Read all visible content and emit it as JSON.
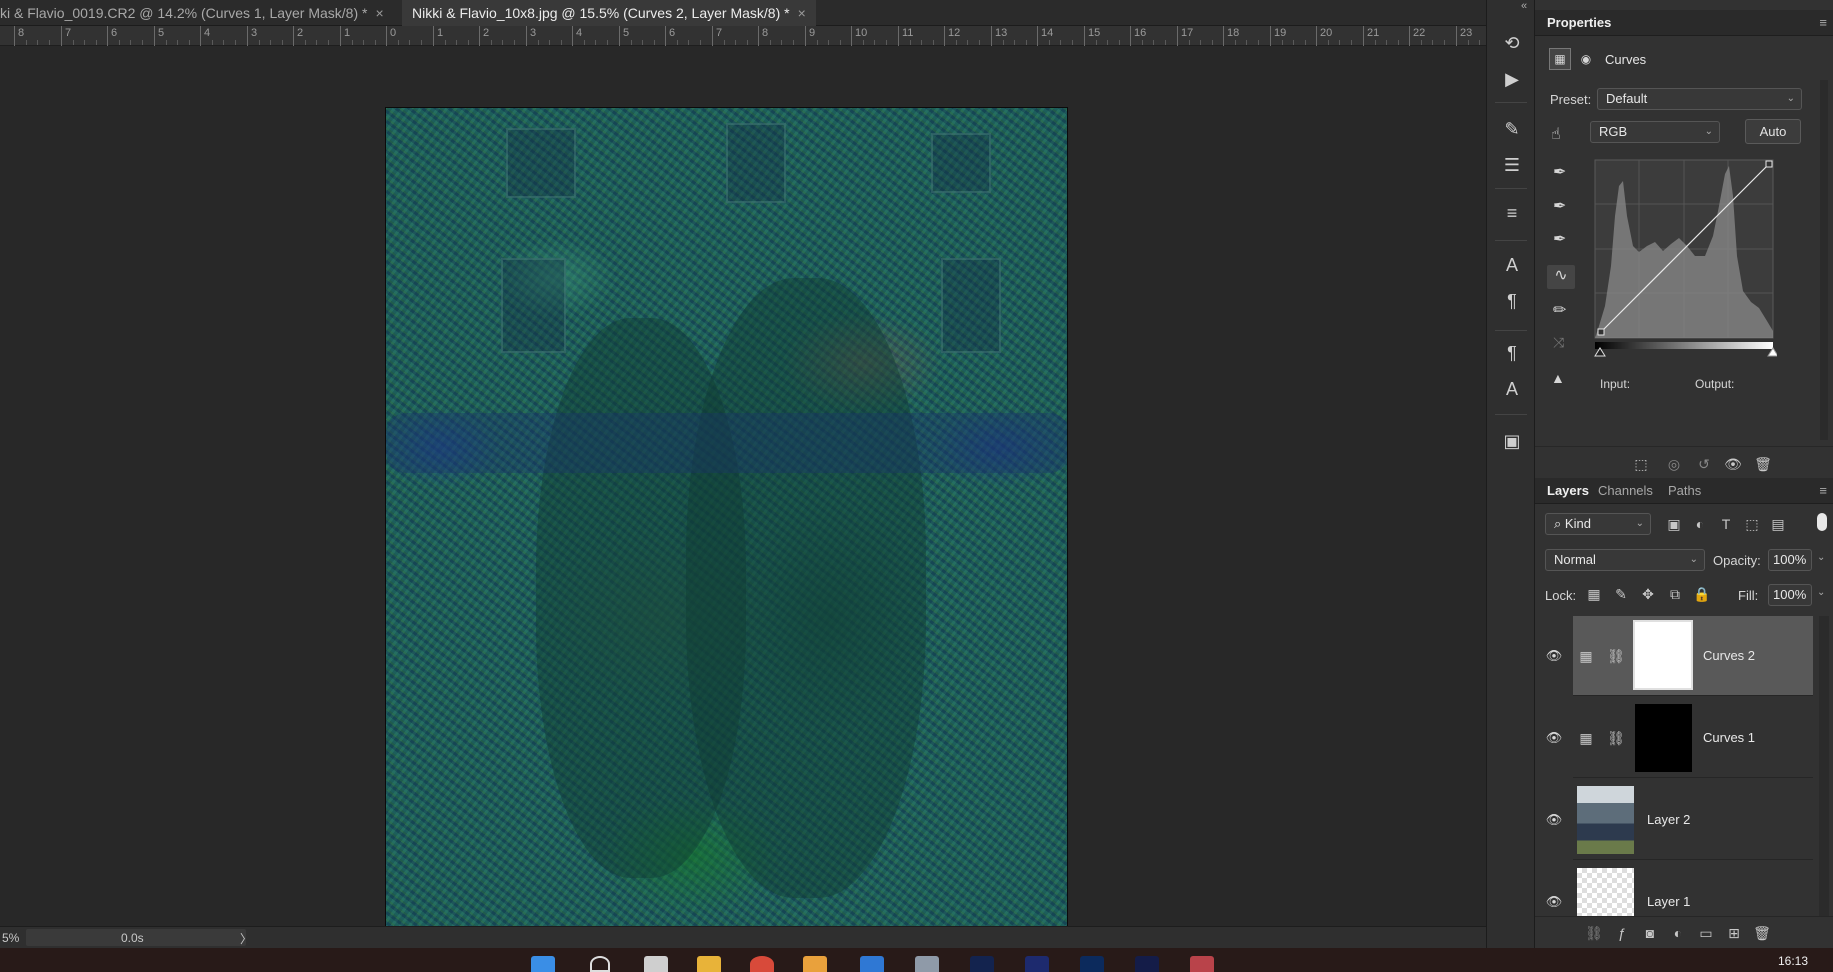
{
  "tabs": [
    {
      "label": "ki & Flavio_0019.CR2 @ 14.2% (Curves 1, Layer Mask/8) *",
      "active": false
    },
    {
      "label": "Nikki & Flavio_10x8.jpg @ 15.5% (Curves 2, Layer Mask/8) *",
      "active": true
    }
  ],
  "close_glyph": "×",
  "ruler": {
    "top_labels": [
      "8",
      "7",
      "6",
      "5",
      "4",
      "3",
      "2",
      "1",
      "0",
      "1",
      "2",
      "3",
      "4",
      "5",
      "6",
      "7",
      "8",
      "9",
      "10",
      "11",
      "12",
      "13",
      "14",
      "15",
      "16",
      "17",
      "18",
      "19",
      "20",
      "21",
      "22",
      "23"
    ]
  },
  "status": {
    "zoom": "5%",
    "timing": "0.0s",
    "arrow": "〉"
  },
  "taskbar": {
    "time": "16:13"
  },
  "properties": {
    "title": "Properties",
    "adjustment_name": "Curves",
    "preset_label": "Preset:",
    "preset_value": "Default",
    "channel_value": "RGB",
    "auto_label": "Auto",
    "input_label": "Input:",
    "output_label": "Output:"
  },
  "layers_panel": {
    "tabs": [
      "Layers",
      "Channels",
      "Paths"
    ],
    "filter_kind": "Kind",
    "blend_mode": "Normal",
    "opacity_label": "Opacity:",
    "opacity_value": "100%",
    "lock_label": "Lock:",
    "fill_label": "Fill:",
    "fill_value": "100%",
    "layers": [
      {
        "name": "Curves 2",
        "selected": true,
        "type": "adjustment",
        "mask": "white"
      },
      {
        "name": "Curves 1",
        "selected": false,
        "type": "adjustment",
        "mask": "black"
      },
      {
        "name": "Layer 2",
        "selected": false,
        "type": "photo"
      },
      {
        "name": "Layer 1",
        "selected": false,
        "type": "transparent"
      }
    ]
  },
  "colors": {
    "accent": "#1473e6",
    "panel_bg": "#323232",
    "canvas_bg": "#282828"
  }
}
